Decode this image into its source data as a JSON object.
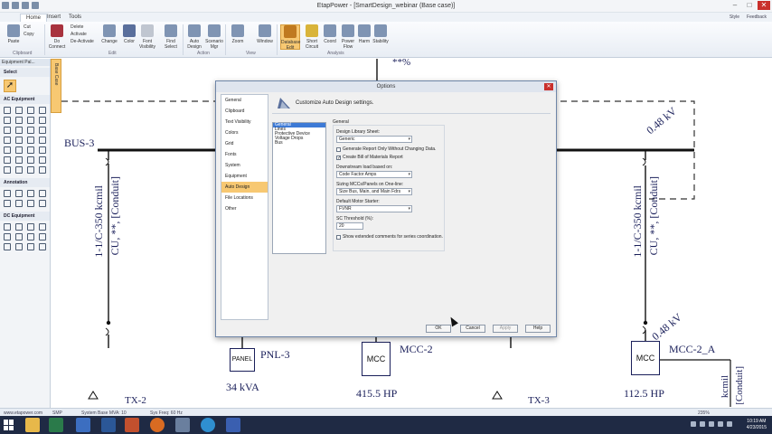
{
  "window": {
    "title": "EtapPower - [SmartDesign_webinar (Base case)]",
    "minimize": "–",
    "maximize": "□",
    "close": "✕"
  },
  "tabs": [
    "Home",
    "Insert",
    "Tools"
  ],
  "help": {
    "style": "Style",
    "feedback": "Feedback"
  },
  "ribbon": {
    "clipboard": {
      "label": "Clipboard",
      "paste": "Paste",
      "cut": "Cut",
      "copy": "Copy"
    },
    "edit": {
      "label": "Edit",
      "do_connect": "Do Connect",
      "delete": "Delete",
      "activate": "Activate",
      "deactivate": "De-Activate",
      "change": "Change",
      "color": "Color",
      "font": "Font Visibility",
      "find": "Find Select"
    },
    "action": {
      "label": "Action",
      "auto_design": "Auto Design",
      "scenario_mgr": "Scenario Mgr"
    },
    "view": {
      "label": "View",
      "zoom": "Zoom",
      "window": "Window"
    },
    "analysis": {
      "label": "Analysis",
      "database_edit": "Database Edit",
      "short_circuit": "Short Circuit",
      "coord": "Coord",
      "power_flow": "Power Flow",
      "harm": "Harm",
      "stability": "Stability"
    }
  },
  "palette": {
    "header": "Equipment Pal...",
    "select": "Select",
    "ac": "AC Equipment",
    "annotation": "Annotation",
    "dc": "DC Equipment",
    "strip": "Base Case"
  },
  "diagram": {
    "bus3": "BUS-3",
    "kv_top": "0.48 kV",
    "kv_mid": "0.48 kV",
    "pct": "**%",
    "cable_left": "1-1/C-350 kcmil",
    "cable_left2": "CU, **, [Conduit]",
    "cable_right": "1-1/C-350 kcmil",
    "cable_right2": "CU, **, [Conduit]",
    "cable_far": "kcmil",
    "cable_far2": "[Conduit]",
    "panel": "PANEL",
    "pnl3": "PNL-3",
    "pnl_kva": "34 kVA",
    "mcc": "MCC",
    "mcc2": "MCC-2",
    "mcc2_hp": "415.5 HP",
    "mcc2a": "MCC-2_A",
    "mcc2a_hp": "112.5 HP",
    "tx2": "TX-2",
    "tx3": "TX-3"
  },
  "dialog": {
    "title": "Options",
    "close": "✕",
    "nav": [
      "General",
      "Clipboard",
      "Text Visibility",
      "Colors",
      "Grid",
      "Fonts",
      "System",
      "Equipment",
      "Auto Design",
      "File Locations",
      "Other"
    ],
    "nav_selected": "Auto Design",
    "header": "Customize Auto Design settings.",
    "categories": [
      "General",
      "Lines",
      "Protective Device",
      "Voltage Drops",
      "Bus"
    ],
    "settings_title": "General",
    "design_library_label": "Design Library Sheet:",
    "design_library_value": "Generic",
    "chk_generate": "Generate Report Only Without Changing Data.",
    "chk_bom": "Create Bill of Materials Report",
    "chk_bom_check": "✓",
    "downstream_label": "Downstream load based on:",
    "downstream_value": "Code Factor Amps",
    "sizing_label": "Sizing MCCs/Panels on One-line:",
    "sizing_value": "Size Bus, Main, and Main Fdrs",
    "motor_label": "Default Motor Starter:",
    "motor_value": "FVNR",
    "sc_label": "SC Threshold (%):",
    "sc_value": "20",
    "chk_extended": "Show extended comments for series coordination.",
    "ok": "OK",
    "cancel": "Cancel",
    "apply": "Apply",
    "help": "Help"
  },
  "status": {
    "link": "www.etapower.com",
    "smp": "SMP",
    "system": "System Base MVA: 10",
    "freq": "Sys Freq: 60 Hz",
    "zoom": "235%"
  },
  "taskbar": {
    "time": "10:19 AM",
    "date": "4/23/2015"
  }
}
